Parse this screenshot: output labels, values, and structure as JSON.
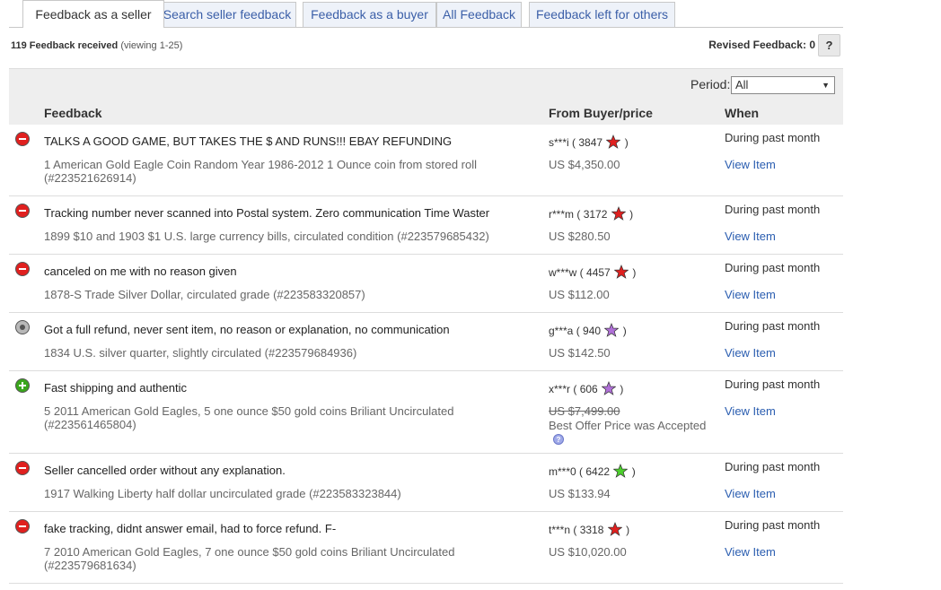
{
  "tabs": [
    {
      "label": "Feedback as a seller",
      "active": true
    },
    {
      "label": "Search seller feedback",
      "active": false
    },
    {
      "label": "Feedback as a buyer",
      "active": false
    },
    {
      "label": "All Feedback",
      "active": false
    },
    {
      "label": "Feedback left for others",
      "active": false
    }
  ],
  "summary": {
    "received": "119 Feedback received",
    "viewing": "(viewing 1-25)",
    "revised": "Revised Feedback: 0",
    "help": "?"
  },
  "period": {
    "label": "Period:",
    "selected": "All"
  },
  "columns": {
    "feedback": "Feedback",
    "from": "From Buyer/price",
    "when": "When"
  },
  "colors": {
    "star_red": "#e0201f",
    "star_purple": "#b070d8",
    "star_green": "#4ccf2c",
    "link": "#2a5db0"
  },
  "rows": [
    {
      "rating": "negative",
      "rating_icon": "negative-minus-icon",
      "comment": "TALKS A GOOD GAME, BUT TAKES THE $ AND RUNS!!! EBAY REFUNDING",
      "item": "1 American Gold Eagle Coin Random Year 1986-2012 1 Ounce coin from stored roll (#223521626914)",
      "buyer": "s***i",
      "score": "3847",
      "star": "red",
      "price": "US $4,350.00",
      "when": "During past month",
      "link": "View Item"
    },
    {
      "rating": "negative",
      "rating_icon": "negative-minus-icon",
      "comment": "Tracking number never scanned into Postal system. Zero communication Time Waster",
      "item": "1899 $10 and 1903 $1 U.S. large currency bills, circulated condition (#223579685432)",
      "buyer": "r***m",
      "score": "3172",
      "star": "red",
      "price": "US $280.50",
      "when": "During past month",
      "link": "View Item"
    },
    {
      "rating": "negative",
      "rating_icon": "negative-minus-icon",
      "comment": "canceled on me with no reason given",
      "item": "1878-S Trade Silver Dollar, circulated grade (#223583320857)",
      "buyer": "w***w",
      "score": "4457",
      "star": "red",
      "price": "US $112.00",
      "when": "During past month",
      "link": "View Item"
    },
    {
      "rating": "neutral",
      "rating_icon": "neutral-dot-icon",
      "comment": "Got a full refund, never sent item, no reason or explanation, no communication",
      "item": "1834 U.S. silver quarter, slightly circulated (#223579684936)",
      "buyer": "g***a",
      "score": "940",
      "star": "purple",
      "price": "US $142.50",
      "when": "During past month",
      "link": "View Item"
    },
    {
      "rating": "positive",
      "rating_icon": "positive-plus-icon",
      "comment": "Fast shipping and authentic",
      "item": "5 2011 American Gold Eagles, 5 one ounce $50 gold coins Briliant Uncirculated (#223561465804)",
      "buyer": "x***r",
      "score": "606",
      "star": "purple",
      "price": "US $7,499.00",
      "price_struck": true,
      "best_offer": "Best Offer Price was Accepted",
      "when": "During past month",
      "link": "View Item"
    },
    {
      "rating": "negative",
      "rating_icon": "negative-minus-icon",
      "comment": "Seller cancelled order without any explanation.",
      "item": "1917 Walking Liberty half dollar uncirculated grade (#223583323844)",
      "buyer": "m***0",
      "score": "6422",
      "star": "green",
      "price": "US $133.94",
      "when": "During past month",
      "link": "View Item"
    },
    {
      "rating": "negative",
      "rating_icon": "negative-minus-icon",
      "comment": "fake tracking, didnt answer email, had to force refund. F-",
      "item": "7 2010 American Gold Eagles, 7 one ounce $50 gold coins Briliant Uncirculated (#223579681634)",
      "buyer": "t***n",
      "score": "3318",
      "star": "red",
      "price": "US $10,020.00",
      "when": "During past month",
      "link": "View Item"
    }
  ]
}
